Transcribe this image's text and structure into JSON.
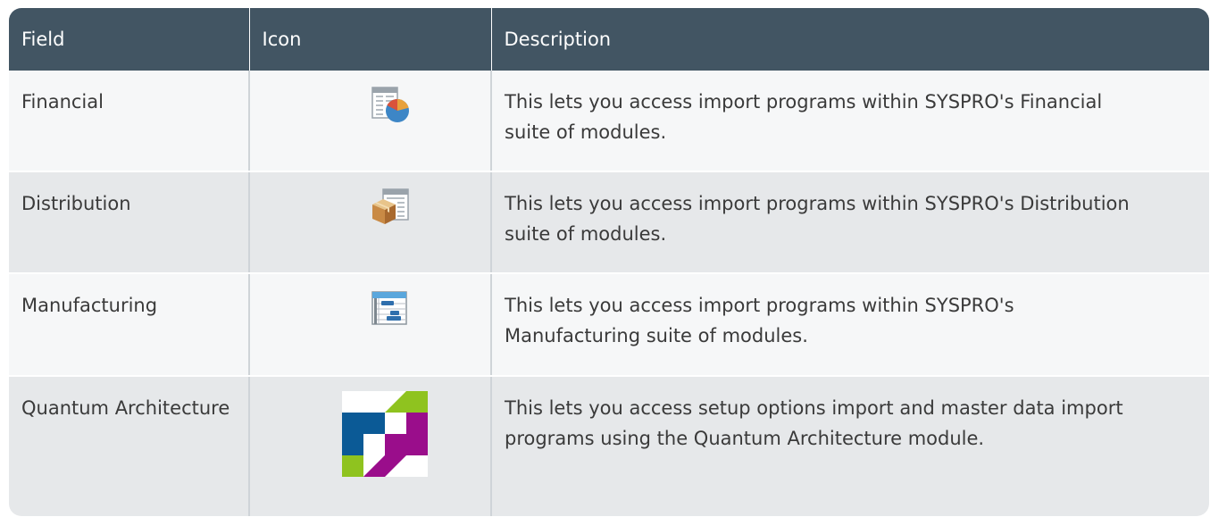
{
  "table": {
    "headers": {
      "field": "Field",
      "icon": "Icon",
      "description": "Description"
    },
    "rows": [
      {
        "field": "Financial",
        "icon": "financial-report-pie-icon",
        "description": "This lets you access import programs within SYSPRO's Financial suite of modules."
      },
      {
        "field": "Distribution",
        "icon": "distribution-box-icon",
        "description": "This lets you access import programs within SYSPRO's Distribution suite of modules."
      },
      {
        "field": "Manufacturing",
        "icon": "manufacturing-gantt-icon",
        "description": "This lets you access import programs within SYSPRO's Manufacturing suite of modules."
      },
      {
        "field": "Quantum Architecture",
        "icon": "quantum-architecture-logo-icon",
        "description": "This lets you access setup options import and master data import programs using the Quantum Architecture module."
      }
    ]
  },
  "colors": {
    "header_bg": "#425563",
    "row_light": "#f6f7f8",
    "row_dark": "#e6e8ea",
    "qa_blue": "#0b5a96",
    "qa_green": "#8fc31f",
    "qa_purple": "#9a0d8b"
  }
}
